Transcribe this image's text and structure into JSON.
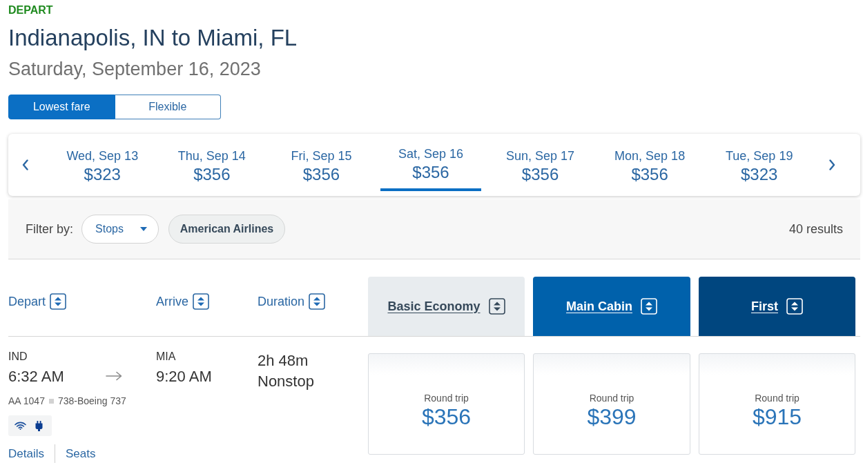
{
  "header": {
    "label": "DEPART",
    "route": "Indianapolis, IN to Miami, FL",
    "date": "Saturday, September 16, 2023"
  },
  "fare_toggle": [
    {
      "label": "Lowest fare",
      "selected": true
    },
    {
      "label": "Flexible",
      "selected": false
    }
  ],
  "date_carousel": {
    "dates": [
      {
        "day": "Wed, Sep 13",
        "price": "$323",
        "selected": false
      },
      {
        "day": "Thu, Sep 14",
        "price": "$356",
        "selected": false
      },
      {
        "day": "Fri, Sep 15",
        "price": "$356",
        "selected": false
      },
      {
        "day": "Sat, Sep 16",
        "price": "$356",
        "selected": true
      },
      {
        "day": "Sun, Sep 17",
        "price": "$356",
        "selected": false
      },
      {
        "day": "Mon, Sep 18",
        "price": "$356",
        "selected": false
      },
      {
        "day": "Tue, Sep 19",
        "price": "$323",
        "selected": false
      }
    ]
  },
  "filter_bar": {
    "label": "Filter by:",
    "filters": [
      {
        "kind": "dropdown",
        "label": "Stops"
      },
      {
        "kind": "chip",
        "label": "American Airlines"
      }
    ],
    "results": "40 results"
  },
  "columns": [
    {
      "label": "Depart"
    },
    {
      "label": "Arrive"
    },
    {
      "label": "Duration"
    }
  ],
  "cabins": [
    {
      "label": "Basic Economy",
      "color": "#e8ecef"
    },
    {
      "label": "Main Cabin",
      "color": "#0061ab"
    },
    {
      "label": "First",
      "color": "#00467f"
    }
  ],
  "flights": [
    {
      "depart": {
        "airport": "IND",
        "time": "6:32 AM"
      },
      "arrive": {
        "airport": "MIA",
        "time": "9:20 AM"
      },
      "duration": "2h 48m",
      "stops": "Nonstop",
      "flight_number": "AA 1047",
      "aircraft": "738-Boeing 737",
      "links": [
        "Details",
        "Seats"
      ],
      "fares": [
        {
          "label": "Round trip",
          "price": "$356"
        },
        {
          "label": "Round trip",
          "price": "$399"
        },
        {
          "label": "Round trip",
          "price": "$915"
        }
      ]
    }
  ]
}
